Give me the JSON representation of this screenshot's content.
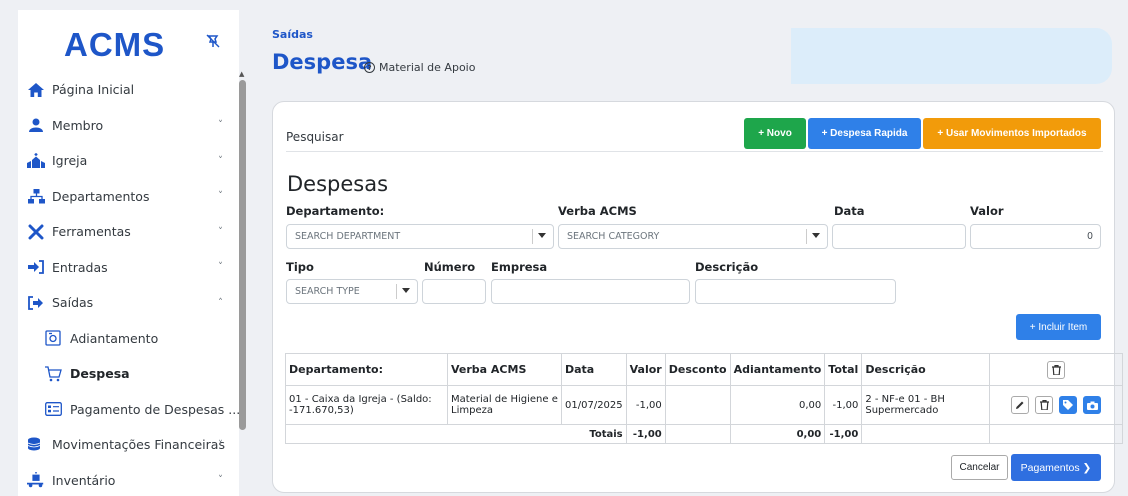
{
  "logo": "ACMS",
  "sidebar": {
    "items": [
      {
        "label": "Página Inicial",
        "icon": "home-icon",
        "chev": ""
      },
      {
        "label": "Membro",
        "icon": "user-icon",
        "chev": "˅"
      },
      {
        "label": "Igreja",
        "icon": "church-icon",
        "chev": "˅"
      },
      {
        "label": "Departamentos",
        "icon": "sitemap-icon",
        "chev": "˅"
      },
      {
        "label": "Ferramentas",
        "icon": "tools-icon",
        "chev": "˅"
      },
      {
        "label": "Entradas",
        "icon": "sign-in-icon",
        "chev": "˅"
      },
      {
        "label": "Saídas",
        "icon": "sign-out-icon",
        "chev": "˄"
      },
      {
        "label": "Adiantamento",
        "icon": "camera-box-icon",
        "chev": ""
      },
      {
        "label": "Despesa",
        "icon": "cart-icon",
        "chev": ""
      },
      {
        "label": "Pagamento de Despesas ...",
        "icon": "list-card-icon",
        "chev": ""
      },
      {
        "label": "Movimentações Financeiras",
        "icon": "coins-icon",
        "chev": "˅"
      },
      {
        "label": "Inventário",
        "icon": "dolly-icon",
        "chev": "˅"
      }
    ]
  },
  "header": {
    "breadcrumb": "Saídas",
    "title": "Despesa",
    "subtitle": "Material de Apoio",
    "help_glyph": "?"
  },
  "toolbar": {
    "search_label": "Pesquisar",
    "novo": "+ Novo",
    "rapida": "+ Despesa Rapida",
    "importados": "+ Usar Movimentos Importados"
  },
  "form": {
    "heading": "Despesas",
    "departamento_label": "Departamento:",
    "departamento_placeholder": "SEARCH DEPARTMENT",
    "verba_label": "Verba ACMS",
    "verba_placeholder": "SEARCH CATEGORY",
    "data_label": "Data",
    "valor_label": "Valor",
    "valor_value": "0",
    "tipo_label": "Tipo",
    "tipo_placeholder": "SEARCH TYPE",
    "numero_label": "Número",
    "empresa_label": "Empresa",
    "descricao_label": "Descrição",
    "incluir": "+ Incluir Item"
  },
  "table": {
    "headers": [
      "Departamento:",
      "Verba ACMS",
      "Data",
      "Valor",
      "Desconto",
      "Adiantamento",
      "Total",
      "Descrição"
    ],
    "rows": [
      {
        "departamento": "01 - Caixa da Igreja - (Saldo: -171.670,53)",
        "verba": "Material de Higiene e Limpeza",
        "data": "01/07/2025",
        "valor": "-1,00",
        "desconto": "",
        "adiantamento": "0,00",
        "total": "-1,00",
        "descricao": "2 - NF-e 01 - BH Supermercado"
      }
    ],
    "totals_label": "Totais",
    "totals_valor": "-1,00",
    "totals_adiantamento": "0,00",
    "totals_total": "-1,00"
  },
  "footer": {
    "cancel": "Cancelar",
    "pagamentos": "Pagamentos ❯"
  },
  "colors": {
    "primary": "#1e56c8",
    "green": "#1ea64b",
    "blue": "#2f80e8",
    "orange": "#f29b0a"
  }
}
